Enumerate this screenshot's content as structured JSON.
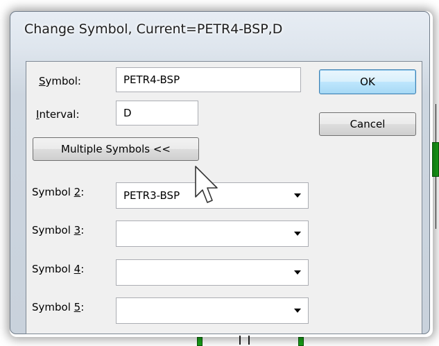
{
  "dialog": {
    "title": "Change Symbol, Current=PETR4-BSP,D"
  },
  "symbol": {
    "label_prefix": "",
    "label_access": "S",
    "label_rest": "ymbol:",
    "value": "PETR4-BSP"
  },
  "interval": {
    "label_access": "I",
    "label_rest": "nterval:",
    "value": "D"
  },
  "buttons": {
    "ok": "OK",
    "cancel": "Cancel",
    "multiple": "Multiple Symbols <<"
  },
  "extra_symbols": [
    {
      "label_prefix": "Symbol ",
      "label_access": "2",
      "label_suffix": ":",
      "value": "PETR3-BSP"
    },
    {
      "label_prefix": "Symbol ",
      "label_access": "3",
      "label_suffix": ":",
      "value": ""
    },
    {
      "label_prefix": "Symbol ",
      "label_access": "4",
      "label_suffix": ":",
      "value": ""
    },
    {
      "label_prefix": "Symbol ",
      "label_access": "5",
      "label_suffix": ":",
      "value": ""
    }
  ],
  "colors": {
    "candle_green": "#18a018",
    "default_button_border": "#3c7fb1"
  }
}
